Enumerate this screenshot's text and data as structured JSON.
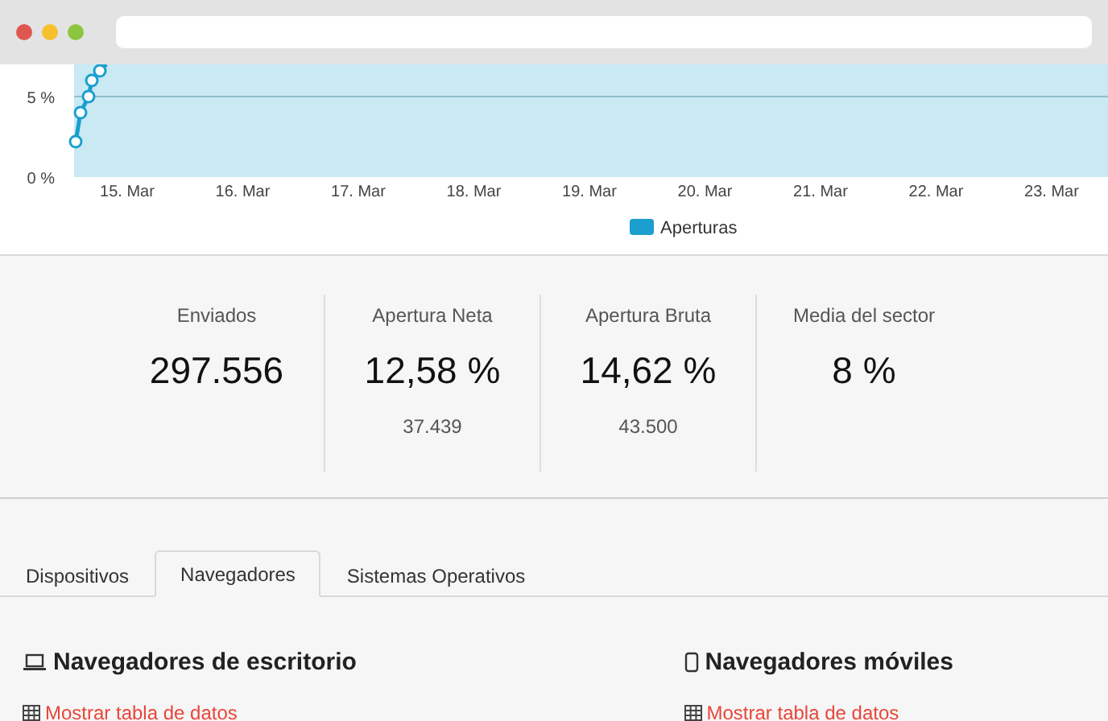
{
  "chart": {
    "y_labels": [
      "5 %",
      "0 %"
    ],
    "x_labels": [
      "15. Mar",
      "16. Mar",
      "17. Mar",
      "18. Mar",
      "19. Mar",
      "20. Mar",
      "21. Mar",
      "22. Mar",
      "23. Mar"
    ],
    "legend": "Aperturas"
  },
  "stats": [
    {
      "label": "Enviados",
      "value": "297.556"
    },
    {
      "label": "Apertura Neta",
      "value": "12,58 %",
      "sub": "37.439"
    },
    {
      "label": "Apertura Bruta",
      "value": "14,62 %",
      "sub": "43.500"
    },
    {
      "label": "Media del sector",
      "value": "8 %"
    }
  ],
  "tabs": [
    {
      "label": "Dispositivos",
      "selected": false
    },
    {
      "label": "Navegadores",
      "selected": true
    },
    {
      "label": "Sistemas Operativos",
      "selected": false
    }
  ],
  "sections": [
    {
      "kind": "laptop",
      "title": "Navegadores de escritorio",
      "link": "Mostrar tabla de datos"
    },
    {
      "kind": "phone",
      "title": "Navegadores móviles",
      "link": "Mostrar tabla de datos"
    }
  ]
}
